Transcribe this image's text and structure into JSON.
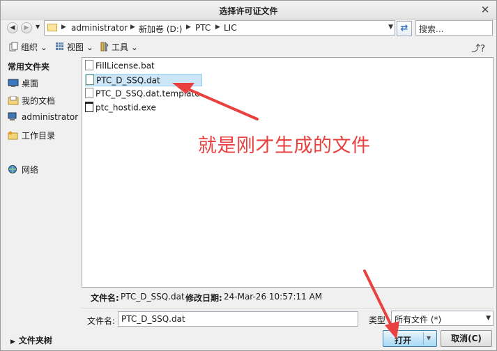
{
  "window": {
    "title": "选择许可证文件",
    "close_glyph": "✕"
  },
  "navigation": {
    "back_glyph": "◀",
    "forward_glyph": "▶",
    "history_drop_glyph": "▼",
    "breadcrumbs": [
      "administrator",
      "新加卷 (D:)",
      "PTC",
      "LIC"
    ],
    "crumb_separator_glyph": "▶",
    "address_drop_glyph": "▼",
    "refresh_glyph": "⇄",
    "search_placeholder": "搜索..."
  },
  "toolbar": {
    "organize_label": "组织",
    "view_label": "视图",
    "tools_label": "工具",
    "drop_glyph": "⌄",
    "help_glyph": "⤴?"
  },
  "sidebar": {
    "header": "常用文件夹",
    "items": [
      {
        "label": "桌面",
        "icon": "desktop-icon"
      },
      {
        "label": "我的文档",
        "icon": "documents-icon"
      },
      {
        "label": "administrator",
        "icon": "computer-icon"
      },
      {
        "label": "工作目录",
        "icon": "working-dir-icon"
      },
      {
        "label": "网络",
        "icon": "network-icon"
      }
    ]
  },
  "files": [
    {
      "name": "FillLicense.bat",
      "icon": "bat-file-icon",
      "selected": false
    },
    {
      "name": "PTC_D_SSQ.dat",
      "icon": "dat-file-icon",
      "selected": true
    },
    {
      "name": "PTC_D_SSQ.dat.template",
      "icon": "generic-file-icon",
      "selected": false
    },
    {
      "name": "ptc_hostid.exe",
      "icon": "exe-file-icon",
      "selected": false
    }
  ],
  "annotation": {
    "text": "就是刚才生成的文件",
    "color": "#e9413f"
  },
  "details": {
    "filename_label": "文件名:",
    "filename_value": "PTC_D_SSQ.dat",
    "modified_label": "修改日期:",
    "modified_value": "24-Mar-26 10:57:11 AM"
  },
  "file_input": {
    "label": "文件名:",
    "value": "PTC_D_SSQ.dat",
    "type_label": "类型",
    "type_value": "所有文件 (*)",
    "type_drop_glyph": "▼"
  },
  "footer": {
    "folder_tree_label": "文件夹树",
    "folder_tree_glyph": "▶",
    "open_label": "打开",
    "open_drop_glyph": "▼",
    "cancel_label": "取消(C)"
  }
}
